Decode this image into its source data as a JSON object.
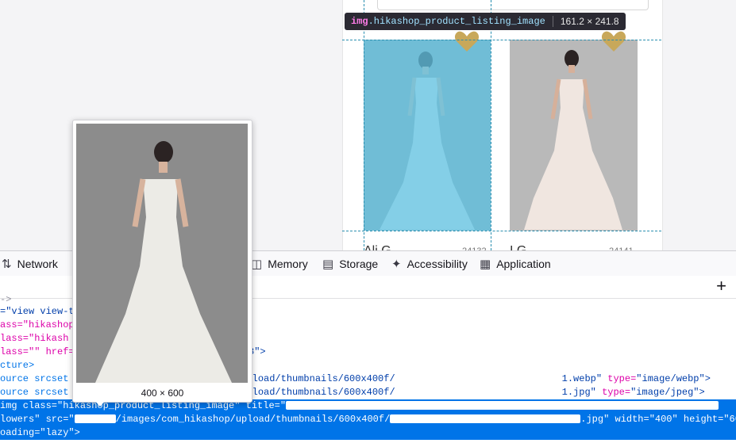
{
  "inspector_tooltip": {
    "tag": "img",
    "class_name": ".hikashop_product_listing_image",
    "dimensions": "161.2 × 241.8"
  },
  "products": [
    {
      "name_clip": "Ali  G",
      "code_clip": "24132"
    },
    {
      "name_clip": "I     G",
      "code_clip": "24141"
    }
  ],
  "devtools": {
    "tabs": [
      {
        "label": "Network",
        "icon": "network-icon"
      },
      {
        "label": "Memory",
        "icon": "memory-icon"
      },
      {
        "label": "Storage",
        "icon": "storage-icon"
      },
      {
        "label": "Accessibility",
        "icon": "accessibility-icon"
      },
      {
        "label": "Application",
        "icon": "application-icon"
      }
    ],
    "add_button": "+",
    "code_lines": {
      "l0": "->",
      "l1_a": "=\"view view-t",
      "l2_a": "ass=\"hikashop_",
      "l3_a": "lass=\"hikash",
      "l4_a": "lass=\"\" href=\"",
      "l4_b": "38\">",
      "l5_a": "cture>",
      "l6_a": "ource srcset",
      "l6_b": "pload/thumbnails/600x400f/",
      "l6_c": "1.webp\"",
      "l6_d": "type=",
      "l6_e": "\"image/webp\">",
      "l7_a": "ource srcset",
      "l7_b": "pload/thumbnails/600x400f/",
      "l7_c": "1.jpg\"",
      "l7_d": "type=",
      "l7_e": "\"image/jpeg\">",
      "sel1_a": "img class=\"hikashop_product_listing_image\" title=\"",
      "sel2_a": "lowers\" src=\"",
      "sel2_b": "/images/com_hikashop/upload/thumbnails/600x400f/",
      "sel2_c": ".jpg\" width=\"400\" height=\"600\"",
      "sel3_a": "oading=\"lazy\">"
    }
  },
  "preview": {
    "dimensions": "400 × 600"
  },
  "colors": {
    "highlight": "#5bc4e6",
    "selection": "#0074e8",
    "heart": "#c8a85a"
  }
}
